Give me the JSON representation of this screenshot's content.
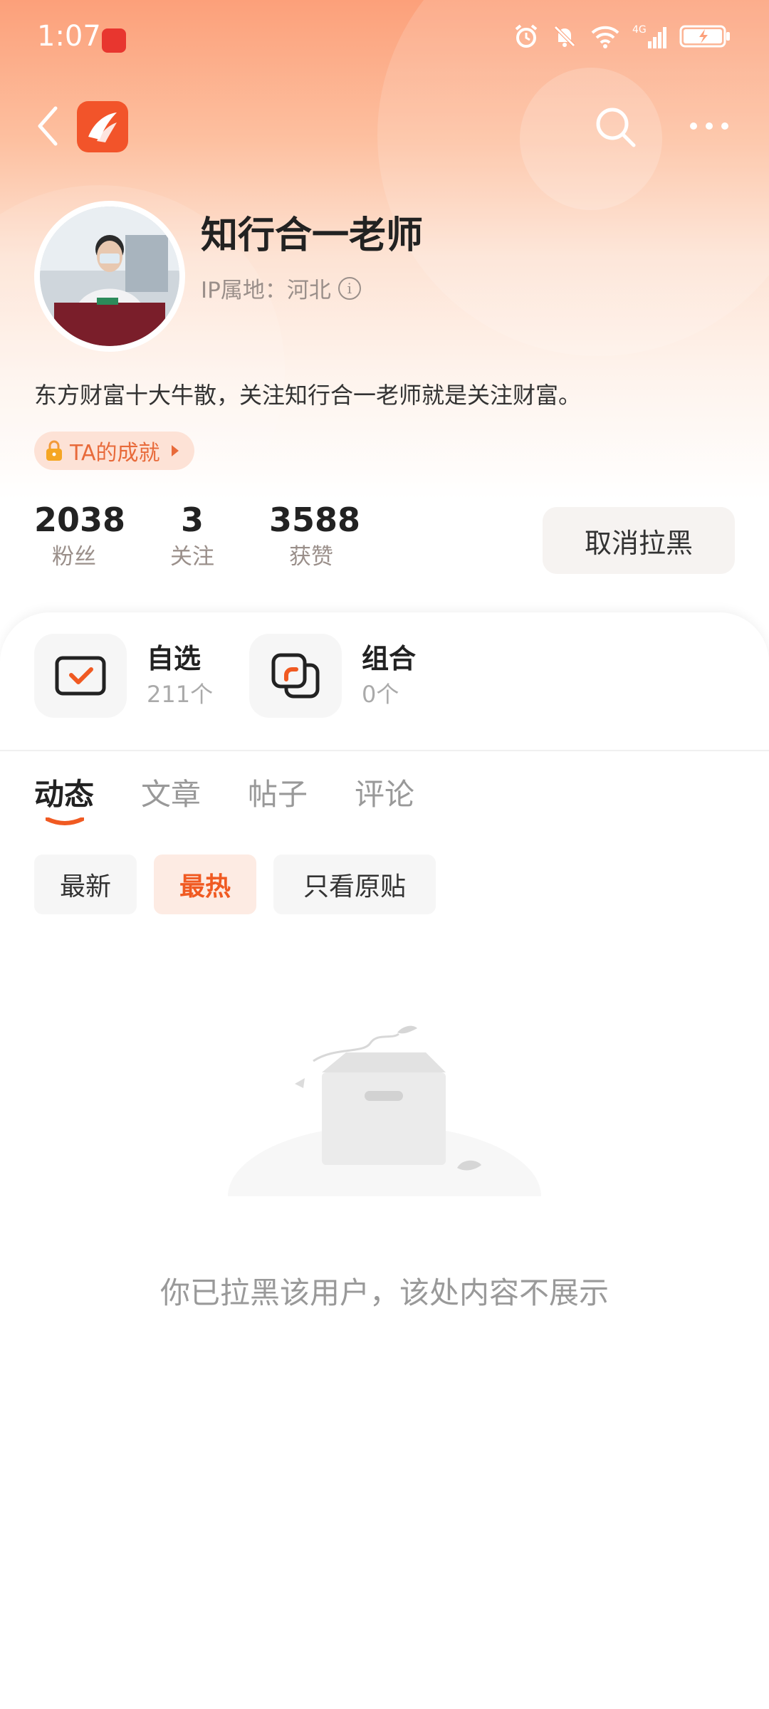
{
  "status_bar": {
    "time": "1:07",
    "network_label": "4G"
  },
  "nav": {
    "back_icon": "chevron-left-icon",
    "logo_icon": "app-logo-icon",
    "search_icon": "search-icon",
    "more_icon": "more-dots-icon"
  },
  "profile": {
    "username": "知行合一老师",
    "ip_location": "IP属地：河北",
    "bio": "东方财富十大牛散，关注知行合一老师就是关注财富。",
    "achievement_label": "TA的成就"
  },
  "stats": [
    {
      "value": "2038",
      "label": "粉丝"
    },
    {
      "value": "3",
      "label": "关注"
    },
    {
      "value": "3588",
      "label": "获赞"
    }
  ],
  "unblock_button": "取消拉黑",
  "quick_items": [
    {
      "title": "自选",
      "count": "211个",
      "icon": "watchlist-check-icon"
    },
    {
      "title": "组合",
      "count": "0个",
      "icon": "portfolio-icon"
    }
  ],
  "tabs": [
    {
      "label": "动态",
      "active": true
    },
    {
      "label": "文章",
      "active": false
    },
    {
      "label": "帖子",
      "active": false
    },
    {
      "label": "评论",
      "active": false
    }
  ],
  "filters": [
    {
      "label": "最新",
      "active": false
    },
    {
      "label": "最热",
      "active": true
    },
    {
      "label": "只看原贴",
      "active": false
    }
  ],
  "empty_state": {
    "message": "你已拉黑该用户，该处内容不展示",
    "icon": "empty-box-icon"
  },
  "colors": {
    "accent": "#f05a22",
    "header_gradient_top": "#fca07a"
  }
}
